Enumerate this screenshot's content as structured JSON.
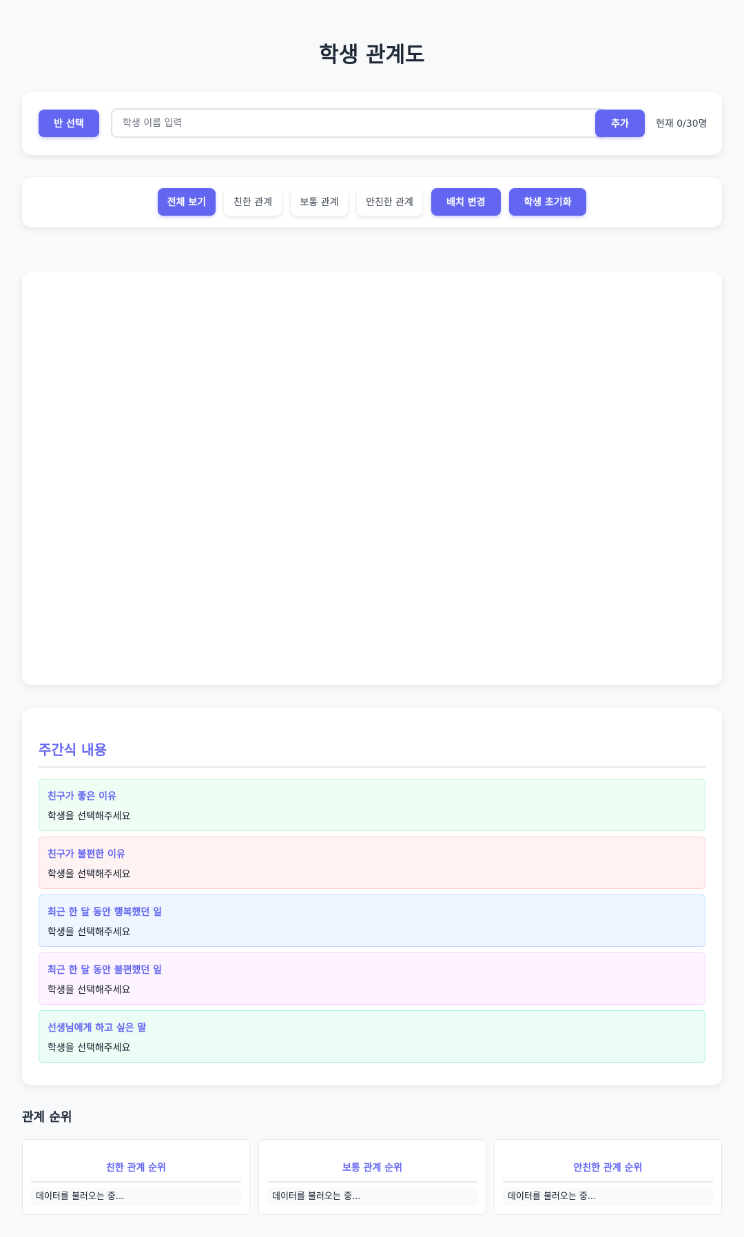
{
  "page": {
    "title": "학생 관계도"
  },
  "toolbar": {
    "class_select_label": "반 선택",
    "name_placeholder": "학생 이름 입력",
    "name_value": "",
    "add_label": "추가",
    "count_text": "현재 0/30명"
  },
  "filters": {
    "all_label": "전체 보기",
    "close_label": "친한 관계",
    "normal_label": "보통 관계",
    "distant_label": "안친한 관계",
    "arrange_label": "배치 변경",
    "reset_label": "학생 초기화"
  },
  "answers": {
    "heading": "주간식 내용",
    "items": [
      {
        "title": "친구가 좋은 이유",
        "body": "학생을 선택해주세요",
        "bg": "#f0fdf4",
        "border": "#bbf7d0"
      },
      {
        "title": "친구가 불편한 이유",
        "body": "학생을 선택해주세요",
        "bg": "#fef2f2",
        "border": "#fecaca"
      },
      {
        "title": "최근 한 달 동안 행복했던 일",
        "body": "학생을 선택해주세요",
        "bg": "#eff6ff",
        "border": "#bfdbfe"
      },
      {
        "title": "최근 한 달 동안 불편했던 일",
        "body": "학생을 선택해주세요",
        "bg": "#fdf4ff",
        "border": "#f5d0fe"
      },
      {
        "title": "선생님에게 하고 싶은 말",
        "body": "학생을 선택해주세요",
        "bg": "#ecfdf5",
        "border": "#a7f3d0"
      }
    ]
  },
  "ranking": {
    "heading": "관계 순위",
    "cards": [
      {
        "title": "친한 관계 순위",
        "loading": "데이터를 불러오는 중..."
      },
      {
        "title": "보통 관계 순위",
        "loading": "데이터를 불러오는 중..."
      },
      {
        "title": "안친한 관계 순위",
        "loading": "데이터를 불러오는 중..."
      }
    ]
  },
  "colors": {
    "accent": "#6366f1",
    "background": "#f8f9fb"
  }
}
